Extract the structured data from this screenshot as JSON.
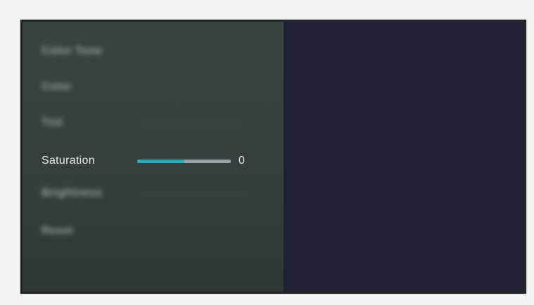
{
  "menu": {
    "items": [
      {
        "label": "Color Tone"
      },
      {
        "label": "Color"
      },
      {
        "label": "Tint"
      },
      {
        "label": "Saturation",
        "value": "0",
        "level_fraction": 0.5
      },
      {
        "label": "Brightness"
      },
      {
        "label": "Reset"
      }
    ]
  },
  "colors": {
    "menu_background": "#3a4342",
    "preview_background": "#222035",
    "slider_fill": "#2fa9b9",
    "slider_track": "#9aa3a3"
  }
}
